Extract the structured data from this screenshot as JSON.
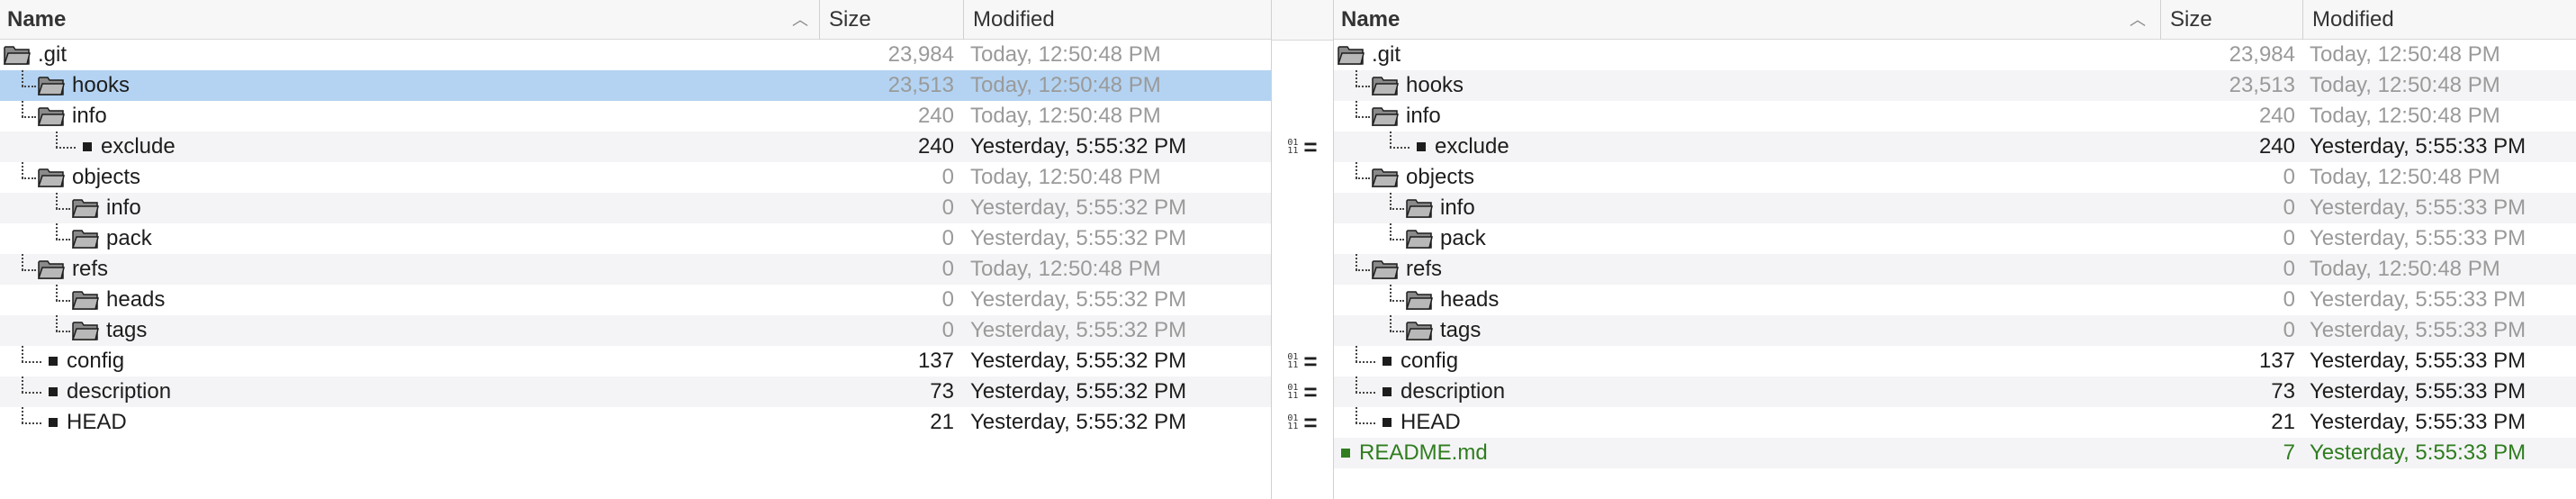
{
  "columns": {
    "name": "Name",
    "size": "Size",
    "modified": "Modified"
  },
  "colors": {
    "selected": "#b4d3f2",
    "stripe": "#f4f4f6",
    "added": "#2f7d1f",
    "muted": "#9a9a9a"
  },
  "left": {
    "rows": [
      {
        "kind": "folder",
        "depth": 0,
        "name": ".git",
        "size": "23,984",
        "modified": "Today, 12:50:48 PM",
        "muted": true
      },
      {
        "kind": "folder",
        "depth": 1,
        "name": "hooks",
        "size": "23,513",
        "modified": "Today, 12:50:48 PM",
        "muted": true,
        "selected": true
      },
      {
        "kind": "folder",
        "depth": 1,
        "name": "info",
        "size": "240",
        "modified": "Today, 12:50:48 PM",
        "muted": true
      },
      {
        "kind": "file",
        "depth": 2,
        "name": "exclude",
        "size": "240",
        "modified": "Yesterday, 5:55:32 PM",
        "muted": false
      },
      {
        "kind": "folder",
        "depth": 1,
        "name": "objects",
        "size": "0",
        "modified": "Today, 12:50:48 PM",
        "muted": true
      },
      {
        "kind": "folder",
        "depth": 2,
        "name": "info",
        "size": "0",
        "modified": "Yesterday, 5:55:32 PM",
        "muted": true
      },
      {
        "kind": "folder",
        "depth": 2,
        "name": "pack",
        "size": "0",
        "modified": "Yesterday, 5:55:32 PM",
        "muted": true
      },
      {
        "kind": "folder",
        "depth": 1,
        "name": "refs",
        "size": "0",
        "modified": "Today, 12:50:48 PM",
        "muted": true
      },
      {
        "kind": "folder",
        "depth": 2,
        "name": "heads",
        "size": "0",
        "modified": "Yesterday, 5:55:32 PM",
        "muted": true
      },
      {
        "kind": "folder",
        "depth": 2,
        "name": "tags",
        "size": "0",
        "modified": "Yesterday, 5:55:32 PM",
        "muted": true
      },
      {
        "kind": "file",
        "depth": 1,
        "name": "config",
        "size": "137",
        "modified": "Yesterday, 5:55:32 PM",
        "muted": false
      },
      {
        "kind": "file",
        "depth": 1,
        "name": "description",
        "size": "73",
        "modified": "Yesterday, 5:55:32 PM",
        "muted": false
      },
      {
        "kind": "file",
        "depth": 1,
        "name": "HEAD",
        "size": "21",
        "modified": "Yesterday, 5:55:32 PM",
        "muted": false
      }
    ]
  },
  "right": {
    "rows": [
      {
        "kind": "folder",
        "depth": 0,
        "name": ".git",
        "size": "23,984",
        "modified": "Today, 12:50:48 PM",
        "muted": true
      },
      {
        "kind": "folder",
        "depth": 1,
        "name": "hooks",
        "size": "23,513",
        "modified": "Today, 12:50:48 PM",
        "muted": true
      },
      {
        "kind": "folder",
        "depth": 1,
        "name": "info",
        "size": "240",
        "modified": "Today, 12:50:48 PM",
        "muted": true
      },
      {
        "kind": "file",
        "depth": 2,
        "name": "exclude",
        "size": "240",
        "modified": "Yesterday, 5:55:33 PM",
        "muted": false
      },
      {
        "kind": "folder",
        "depth": 1,
        "name": "objects",
        "size": "0",
        "modified": "Today, 12:50:48 PM",
        "muted": true
      },
      {
        "kind": "folder",
        "depth": 2,
        "name": "info",
        "size": "0",
        "modified": "Yesterday, 5:55:33 PM",
        "muted": true
      },
      {
        "kind": "folder",
        "depth": 2,
        "name": "pack",
        "size": "0",
        "modified": "Yesterday, 5:55:33 PM",
        "muted": true
      },
      {
        "kind": "folder",
        "depth": 1,
        "name": "refs",
        "size": "0",
        "modified": "Today, 12:50:48 PM",
        "muted": true
      },
      {
        "kind": "folder",
        "depth": 2,
        "name": "heads",
        "size": "0",
        "modified": "Yesterday, 5:55:33 PM",
        "muted": true
      },
      {
        "kind": "folder",
        "depth": 2,
        "name": "tags",
        "size": "0",
        "modified": "Yesterday, 5:55:33 PM",
        "muted": true
      },
      {
        "kind": "file",
        "depth": 1,
        "name": "config",
        "size": "137",
        "modified": "Yesterday, 5:55:33 PM",
        "muted": false
      },
      {
        "kind": "file",
        "depth": 1,
        "name": "description",
        "size": "73",
        "modified": "Yesterday, 5:55:33 PM",
        "muted": false
      },
      {
        "kind": "file",
        "depth": 1,
        "name": "HEAD",
        "size": "21",
        "modified": "Yesterday, 5:55:33 PM",
        "muted": false
      },
      {
        "kind": "file",
        "depth": 0,
        "name": "README.md",
        "size": "7",
        "modified": "Yesterday, 5:55:33 PM",
        "muted": false,
        "added": true
      }
    ]
  },
  "gutter": {
    "markers": [
      {
        "row": 3,
        "bits": "01\n11",
        "symbol": "="
      },
      {
        "row": 10,
        "bits": "01\n11",
        "symbol": "="
      },
      {
        "row": 11,
        "bits": "01\n11",
        "symbol": "="
      },
      {
        "row": 12,
        "bits": "01\n11",
        "symbol": "="
      }
    ]
  }
}
